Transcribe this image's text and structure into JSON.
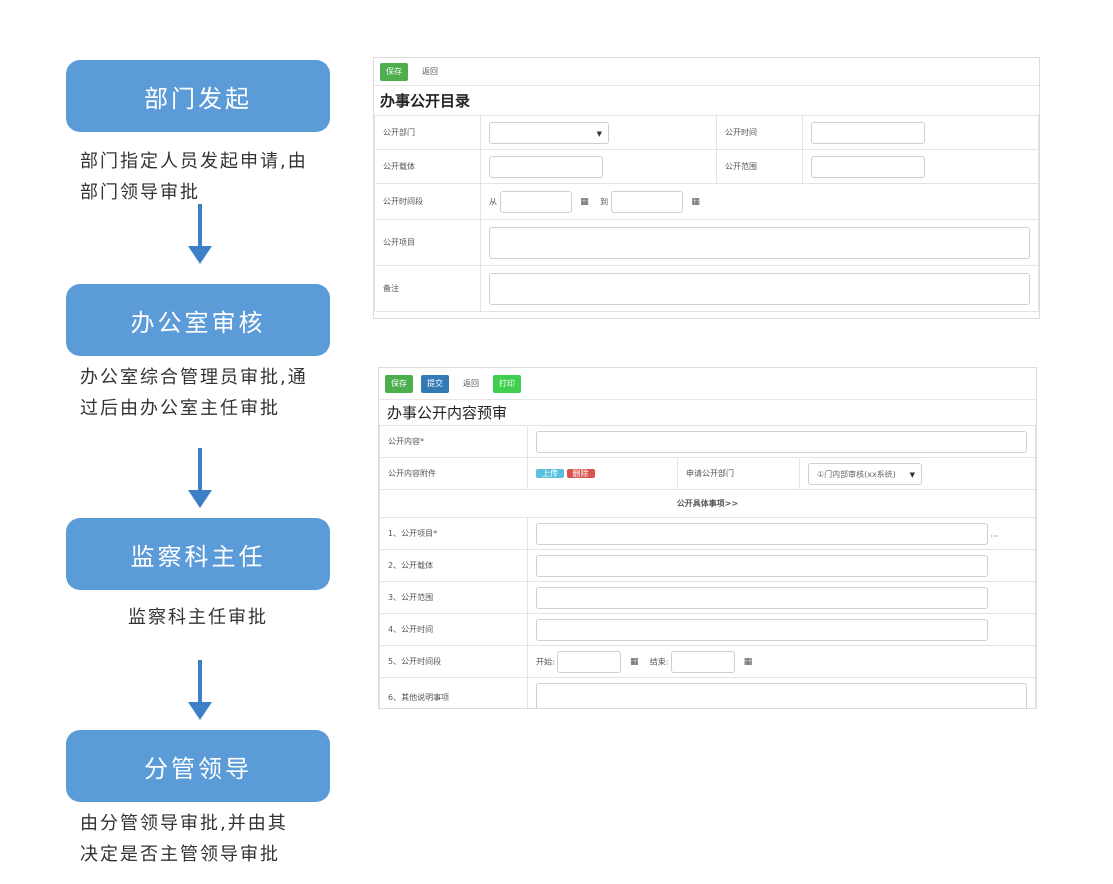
{
  "flow": {
    "steps": [
      {
        "title": "部门发起",
        "desc": [
          "部门指定人员发起申请,由",
          "部门领导审批"
        ]
      },
      {
        "title": "办公室审核",
        "desc": [
          "办公室综合管理员审批,通",
          "过后由办公室主任审批"
        ]
      },
      {
        "title": "监察科主任",
        "desc": [
          "监察科主任审批"
        ]
      },
      {
        "title": "分管领导",
        "desc": [
          "由分管领导审批,并由其",
          "决定是否主管领导审批"
        ]
      }
    ]
  },
  "panel1": {
    "toolbar": {
      "save": "保存",
      "back": "返回"
    },
    "title": "办事公开目录",
    "labels": {
      "dept": "公开部门",
      "time": "公开时间",
      "carrier": "公开载体",
      "scope": "公开范围",
      "period": "公开时间段",
      "from": "从",
      "to": "到",
      "item": "公开项目",
      "remark": "备注"
    }
  },
  "panel2": {
    "toolbar": {
      "save": "保存",
      "submit": "提交",
      "back": "返回",
      "print": "打印"
    },
    "title": "办事公开内容预审",
    "labels": {
      "content": "公开内容*",
      "attachment": "公开内容附件",
      "upload": "上传",
      "delete": "删除",
      "apply_dept": "申请公开部门",
      "apply_dept_value": "①门内部审核(xx系统)",
      "section_link": "公开具体事项>>",
      "row1": "1、公开项目*",
      "row2": "2、公开载体",
      "row3": "3、公开范围",
      "row4": "4、公开时间",
      "row5": "5、公开时间段",
      "start": "开始:",
      "end": "结束:",
      "row6": "6、其他说明事项",
      "ellipsis": "..."
    }
  },
  "icons": {
    "calendar": "calendar-icon",
    "caret": "caret-down-icon",
    "arrow": "arrow-down-icon"
  },
  "colors": {
    "step_box": "#5b9bd8",
    "arrow": "#3f7fc7",
    "save_btn": "#4cae4c",
    "submit_btn": "#337ab7"
  }
}
